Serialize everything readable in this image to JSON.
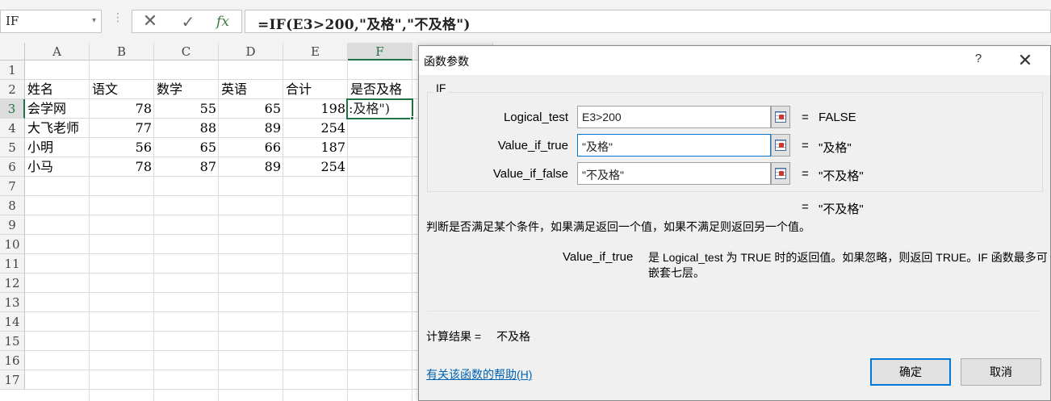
{
  "formula_bar": {
    "name_box": "IF",
    "name_box_arrow": "▾",
    "separator": "⋮",
    "cancel_symbol": "✕",
    "enter_symbol": "✓",
    "fx_symbol": "fx",
    "formula": "=IF(E3>200,\"及格\",\"不及格\")"
  },
  "grid": {
    "columns": [
      "A",
      "B",
      "C",
      "D",
      "E",
      "F"
    ],
    "selected_column": "F",
    "rows": [
      "1",
      "2",
      "3",
      "4",
      "5",
      "6",
      "7",
      "8",
      "9",
      "10",
      "11",
      "12",
      "13",
      "14",
      "15",
      "16",
      "17"
    ],
    "selected_row": "3",
    "header_row": [
      "姓名",
      "语文",
      "数学",
      "英语",
      "合计",
      "是否及格"
    ],
    "data_rows": [
      [
        "会学网",
        "78",
        "55",
        "65",
        "198"
      ],
      [
        "大飞老师",
        "77",
        "88",
        "89",
        "254"
      ],
      [
        "小明",
        "56",
        "65",
        "66",
        "187"
      ],
      [
        "小马",
        "78",
        "87",
        "89",
        "254"
      ]
    ],
    "active_cell_text": ":及格\")",
    "accent_color": "#217346"
  },
  "dialog": {
    "title": "函数参数",
    "help_symbol": "?",
    "close_symbol": "✕",
    "function_name": "IF",
    "args": [
      {
        "label": "Logical_test",
        "value": "E3>200",
        "equals": "=",
        "result": "FALSE"
      },
      {
        "label": "Value_if_true",
        "value": "\"及格\"",
        "equals": "=",
        "result": "\"及格\""
      },
      {
        "label": "Value_if_false",
        "value": "\"不及格\"",
        "equals": "=",
        "result": "\"不及格\""
      }
    ],
    "overall_equals": "=",
    "overall_result": "\"不及格\"",
    "description": "判断是否满足某个条件，如果满足返回一个值，如果不满足则返回另一个值。",
    "arg_help_name": "Value_if_true",
    "arg_help_text": "是 Logical_test 为 TRUE 时的返回值。如果忽略，则返回 TRUE。IF 函数最多可嵌套七层。",
    "calc_result_label": "计算结果 =",
    "calc_result_value": "不及格",
    "help_link": "有关该函数的帮助(H)",
    "ok_label": "确定",
    "cancel_label": "取消",
    "focus_color": "#0078d7"
  }
}
